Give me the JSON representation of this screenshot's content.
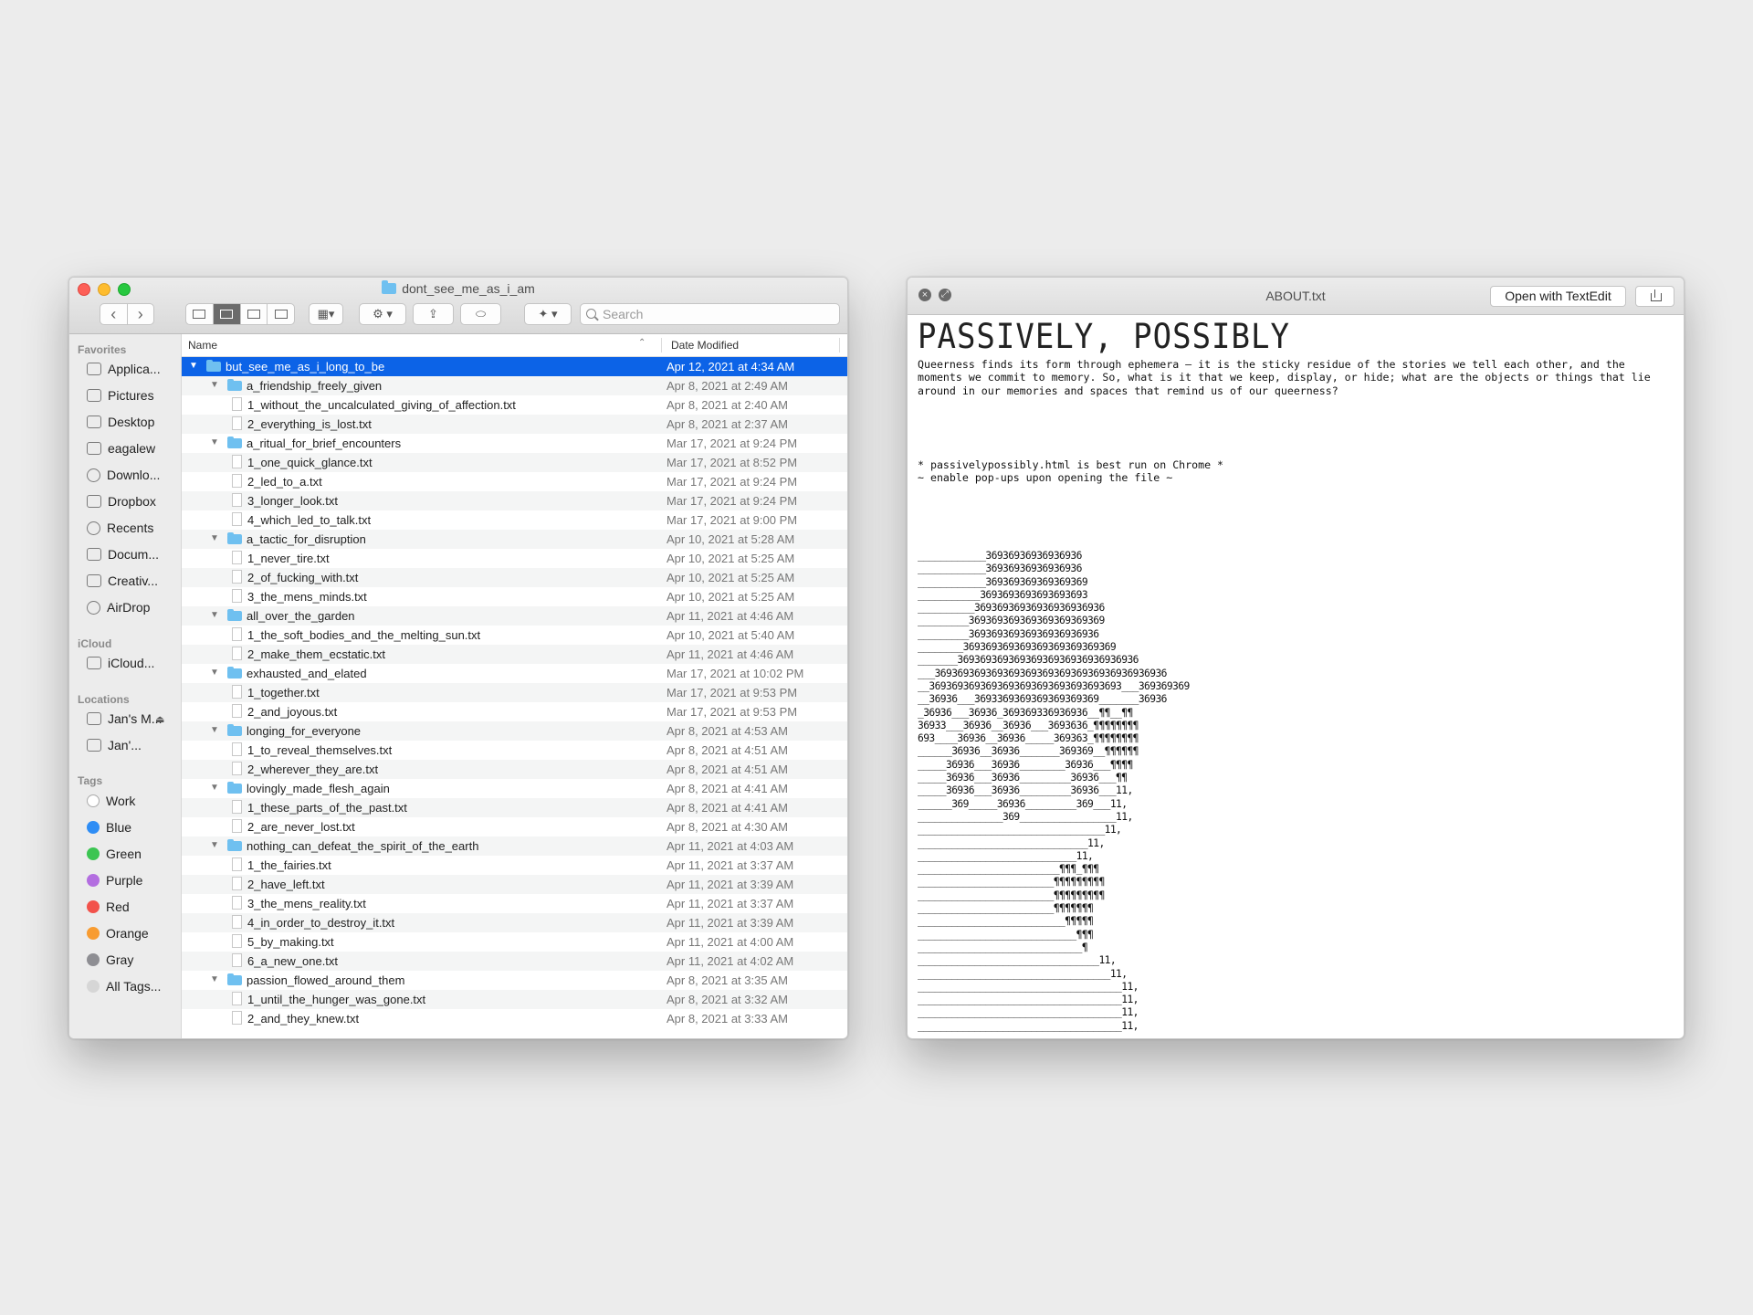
{
  "finder": {
    "title": "dont_see_me_as_i_am",
    "toolbar": {
      "back": "‹",
      "forward": "›",
      "search_placeholder": "Search"
    },
    "sidebar": {
      "favorites_head": "Favorites",
      "favorites": [
        {
          "label": "Applica...",
          "icon": "applications-icon"
        },
        {
          "label": "Pictures",
          "icon": "pictures-icon"
        },
        {
          "label": "Desktop",
          "icon": "desktop-icon"
        },
        {
          "label": "eagalew",
          "icon": "home-icon"
        },
        {
          "label": "Downlo...",
          "icon": "downloads-icon"
        },
        {
          "label": "Dropbox",
          "icon": "dropbox-icon"
        },
        {
          "label": "Recents",
          "icon": "recents-icon"
        },
        {
          "label": "Docum...",
          "icon": "documents-icon"
        },
        {
          "label": "Creativ...",
          "icon": "folder-icon"
        },
        {
          "label": "AirDrop",
          "icon": "airdrop-icon"
        }
      ],
      "icloud_head": "iCloud",
      "icloud": [
        {
          "label": "iCloud...",
          "icon": "icloud-icon"
        }
      ],
      "locations_head": "Locations",
      "locations": [
        {
          "label": "Jan's M...",
          "icon": "computer-icon"
        },
        {
          "label": "Jan'...",
          "icon": "disk-icon"
        }
      ],
      "tags_head": "Tags",
      "tags": [
        {
          "label": "Work",
          "color": "#ffffff"
        },
        {
          "label": "Blue",
          "color": "#2e8df5"
        },
        {
          "label": "Green",
          "color": "#3cc552"
        },
        {
          "label": "Purple",
          "color": "#b36ee0"
        },
        {
          "label": "Red",
          "color": "#f2524b"
        },
        {
          "label": "Orange",
          "color": "#f89c31"
        },
        {
          "label": "Gray",
          "color": "#8e8e93"
        },
        {
          "label": "All Tags...",
          "color": "#d6d6d6"
        }
      ]
    },
    "columns": {
      "name": "Name",
      "date": "Date Modified"
    },
    "rows": [
      {
        "name": "but_see_me_as_i_long_to_be",
        "date": "Apr 12, 2021 at 4:34 AM",
        "kind": "folder",
        "level": 0,
        "selected": true
      },
      {
        "name": "a_friendship_freely_given",
        "date": "Apr 8, 2021 at 2:49 AM",
        "kind": "folder",
        "level": 1
      },
      {
        "name": "1_without_the_uncalculated_giving_of_affection.txt",
        "date": "Apr 8, 2021 at 2:40 AM",
        "kind": "file",
        "level": 2
      },
      {
        "name": "2_everything_is_lost.txt",
        "date": "Apr 8, 2021 at 2:37 AM",
        "kind": "file",
        "level": 2
      },
      {
        "name": "a_ritual_for_brief_encounters",
        "date": "Mar 17, 2021 at 9:24 PM",
        "kind": "folder",
        "level": 1
      },
      {
        "name": "1_one_quick_glance.txt",
        "date": "Mar 17, 2021 at 8:52 PM",
        "kind": "file",
        "level": 2
      },
      {
        "name": "2_led_to_a.txt",
        "date": "Mar 17, 2021 at 9:24 PM",
        "kind": "file",
        "level": 2
      },
      {
        "name": "3_longer_look.txt",
        "date": "Mar 17, 2021 at 9:24 PM",
        "kind": "file",
        "level": 2
      },
      {
        "name": "4_which_led_to_talk.txt",
        "date": "Mar 17, 2021 at 9:00 PM",
        "kind": "file",
        "level": 2
      },
      {
        "name": "a_tactic_for_disruption",
        "date": "Apr 10, 2021 at 5:28 AM",
        "kind": "folder",
        "level": 1
      },
      {
        "name": "1_never_tire.txt",
        "date": "Apr 10, 2021 at 5:25 AM",
        "kind": "file",
        "level": 2
      },
      {
        "name": "2_of_fucking_with.txt",
        "date": "Apr 10, 2021 at 5:25 AM",
        "kind": "file",
        "level": 2
      },
      {
        "name": "3_the_mens_minds.txt",
        "date": "Apr 10, 2021 at 5:25 AM",
        "kind": "file",
        "level": 2
      },
      {
        "name": "all_over_the_garden",
        "date": "Apr 11, 2021 at 4:46 AM",
        "kind": "folder",
        "level": 1
      },
      {
        "name": "1_the_soft_bodies_and_the_melting_sun.txt",
        "date": "Apr 10, 2021 at 5:40 AM",
        "kind": "file",
        "level": 2
      },
      {
        "name": "2_make_them_ecstatic.txt",
        "date": "Apr 11, 2021 at 4:46 AM",
        "kind": "file",
        "level": 2
      },
      {
        "name": "exhausted_and_elated",
        "date": "Mar 17, 2021 at 10:02 PM",
        "kind": "folder",
        "level": 1
      },
      {
        "name": "1_together.txt",
        "date": "Mar 17, 2021 at 9:53 PM",
        "kind": "file",
        "level": 2
      },
      {
        "name": "2_and_joyous.txt",
        "date": "Mar 17, 2021 at 9:53 PM",
        "kind": "file",
        "level": 2
      },
      {
        "name": "longing_for_everyone",
        "date": "Apr 8, 2021 at 4:53 AM",
        "kind": "folder",
        "level": 1
      },
      {
        "name": "1_to_reveal_themselves.txt",
        "date": "Apr 8, 2021 at 4:51 AM",
        "kind": "file",
        "level": 2
      },
      {
        "name": "2_wherever_they_are.txt",
        "date": "Apr 8, 2021 at 4:51 AM",
        "kind": "file",
        "level": 2
      },
      {
        "name": "lovingly_made_flesh_again",
        "date": "Apr 8, 2021 at 4:41 AM",
        "kind": "folder",
        "level": 1
      },
      {
        "name": "1_these_parts_of_the_past.txt",
        "date": "Apr 8, 2021 at 4:41 AM",
        "kind": "file",
        "level": 2
      },
      {
        "name": "2_are_never_lost.txt",
        "date": "Apr 8, 2021 at 4:30 AM",
        "kind": "file",
        "level": 2
      },
      {
        "name": "nothing_can_defeat_the_spirit_of_the_earth",
        "date": "Apr 11, 2021 at 4:03 AM",
        "kind": "folder",
        "level": 1
      },
      {
        "name": "1_the_fairies.txt",
        "date": "Apr 11, 2021 at 3:37 AM",
        "kind": "file",
        "level": 2
      },
      {
        "name": "2_have_left.txt",
        "date": "Apr 11, 2021 at 3:39 AM",
        "kind": "file",
        "level": 2
      },
      {
        "name": "3_the_mens_reality.txt",
        "date": "Apr 11, 2021 at 3:37 AM",
        "kind": "file",
        "level": 2
      },
      {
        "name": "4_in_order_to_destroy_it.txt",
        "date": "Apr 11, 2021 at 3:39 AM",
        "kind": "file",
        "level": 2
      },
      {
        "name": "5_by_making.txt",
        "date": "Apr 11, 2021 at 4:00 AM",
        "kind": "file",
        "level": 2
      },
      {
        "name": "6_a_new_one.txt",
        "date": "Apr 11, 2021 at 4:02 AM",
        "kind": "file",
        "level": 2
      },
      {
        "name": "passion_flowed_around_them",
        "date": "Apr 8, 2021 at 3:35 AM",
        "kind": "folder",
        "level": 1
      },
      {
        "name": "1_until_the_hunger_was_gone.txt",
        "date": "Apr 8, 2021 at 3:32 AM",
        "kind": "file",
        "level": 2
      },
      {
        "name": "2_and_they_knew.txt",
        "date": "Apr 8, 2021 at 3:33 AM",
        "kind": "file",
        "level": 2
      }
    ]
  },
  "viewer": {
    "title": "ABOUT.txt",
    "open_button": "Open with TextEdit",
    "heading": "PASSIVELY, POSSIBLY",
    "paragraph": "Queerness finds its form through ephemera — it is the sticky residue of the stories we tell each other, and the moments we commit to memory. So, what is it that we keep, display, or hide; what are the objects or things that lie around in our memories and spaces that remind us of our queerness?",
    "notes": "* passivelypossibly.html is best run on Chrome *\n~ enable pop-ups upon opening the file ~",
    "ascii_art": "____________36936936936936936\n____________36936936936936936\n____________369369369369369369\n___________3693693693693693693\n__________36936936936936936936936\n_________369369369369369369369369\n_________36936936936936936936936\n________369369369369369369369369369\n_______36936936936936936936936936936936\n___36936936936936936936936936936936936936936\n__3693693693693693693693693693693693___369369369\n__36936___3693369369369369369369_______36936\n_36936___36936_369369336936936__¶¶__¶¶\n36933___36936__36936___3693636_¶¶¶¶¶¶¶¶\n693____36936__36936_____369363_¶¶¶¶¶¶¶¶\n______36936__36936_______369369__¶¶¶¶¶¶\n_____36936___36936________36936___¶¶¶¶\n_____36936___36936_________36936___¶¶\n_____36936___36936_________36936___11,\n______369_____36936_________369___11,\n_______________369_________________11,\n_________________________________11,\n______________________________11,\n____________________________11,\n_________________________¶¶¶_¶¶¶\n________________________¶¶¶¶¶¶¶¶¶\n________________________¶¶¶¶¶¶¶¶¶\n________________________¶¶¶¶¶¶¶\n__________________________¶¶¶¶¶\n____________________________¶¶¶\n_____________________________¶\n________________________________11,\n__________________________________11,\n____________________________________11,\n____________________________________11,\n____________________________________11,\n____________________________________11,"
  }
}
